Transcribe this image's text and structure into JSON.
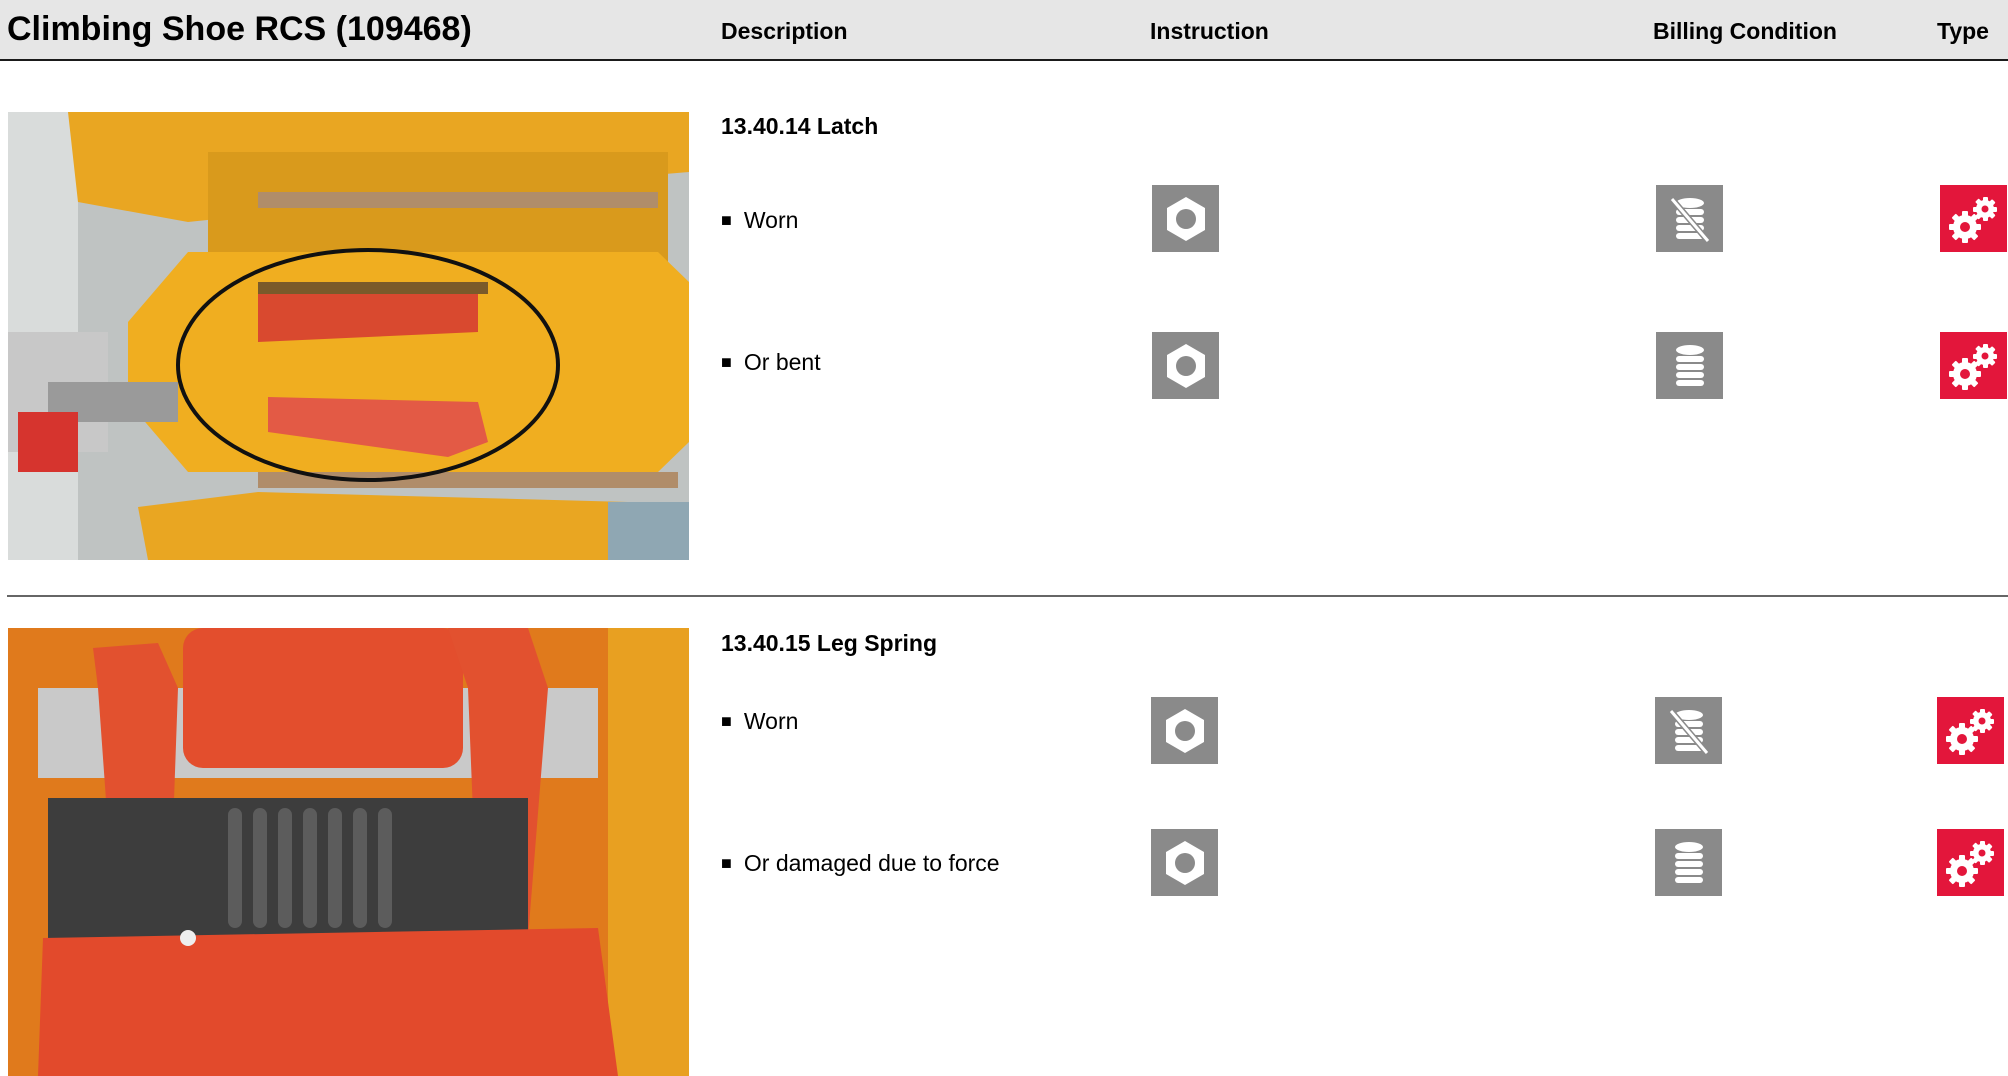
{
  "header": {
    "title": "Climbing Shoe RCS (109468)",
    "columns": {
      "description": "Description",
      "instruction": "Instruction",
      "billing": "Billing Condition",
      "type": "Type"
    }
  },
  "sections": [
    {
      "title": "13.40.14 Latch",
      "rows": [
        {
          "bullet": "■",
          "text": "Worn",
          "instruction_icon": "nut-icon",
          "billing_icon": "coins-crossed-out-icon",
          "type_icon": "gears-icon"
        },
        {
          "bullet": "■",
          "text": "Or bent",
          "instruction_icon": "nut-icon",
          "billing_icon": "coins-icon",
          "type_icon": "gears-icon"
        }
      ]
    },
    {
      "title": "13.40.15 Leg Spring",
      "rows": [
        {
          "bullet": "■",
          "text": "Worn",
          "instruction_icon": "nut-icon",
          "billing_icon": "coins-crossed-out-icon",
          "type_icon": "gears-icon"
        },
        {
          "bullet": "■",
          "text": "Or damaged due to force",
          "instruction_icon": "nut-icon",
          "billing_icon": "coins-icon",
          "type_icon": "gears-icon"
        }
      ]
    }
  ],
  "colors": {
    "header_bg": "#e6e6e6",
    "icon_gray": "#8a8a8a",
    "icon_red": "#e3163b",
    "divider": "#666666"
  }
}
